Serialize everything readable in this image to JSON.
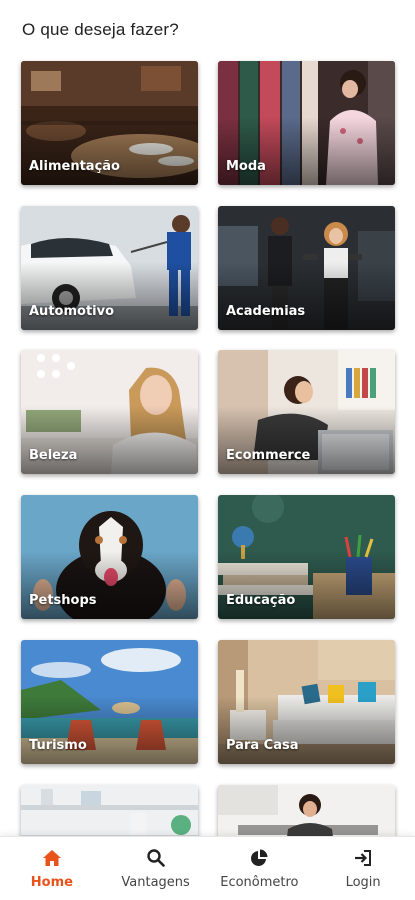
{
  "header": {
    "title": "O que deseja fazer?"
  },
  "categories": [
    {
      "label": "Alimentação"
    },
    {
      "label": "Moda"
    },
    {
      "label": "Automotivo"
    },
    {
      "label": "Academias"
    },
    {
      "label": "Beleza"
    },
    {
      "label": "Ecommerce"
    },
    {
      "label": "Petshops"
    },
    {
      "label": "Educação"
    },
    {
      "label": "Turismo"
    },
    {
      "label": "Para Casa"
    },
    {
      "label": ""
    },
    {
      "label": ""
    }
  ],
  "nav": {
    "items": [
      {
        "label": "Home",
        "icon": "home-icon",
        "active": true
      },
      {
        "label": "Vantagens",
        "icon": "search-icon",
        "active": false
      },
      {
        "label": "Econômetro",
        "icon": "pie-chart-icon",
        "active": false
      },
      {
        "label": "Login",
        "icon": "login-icon",
        "active": false
      }
    ],
    "active_color": "#e8531b"
  }
}
